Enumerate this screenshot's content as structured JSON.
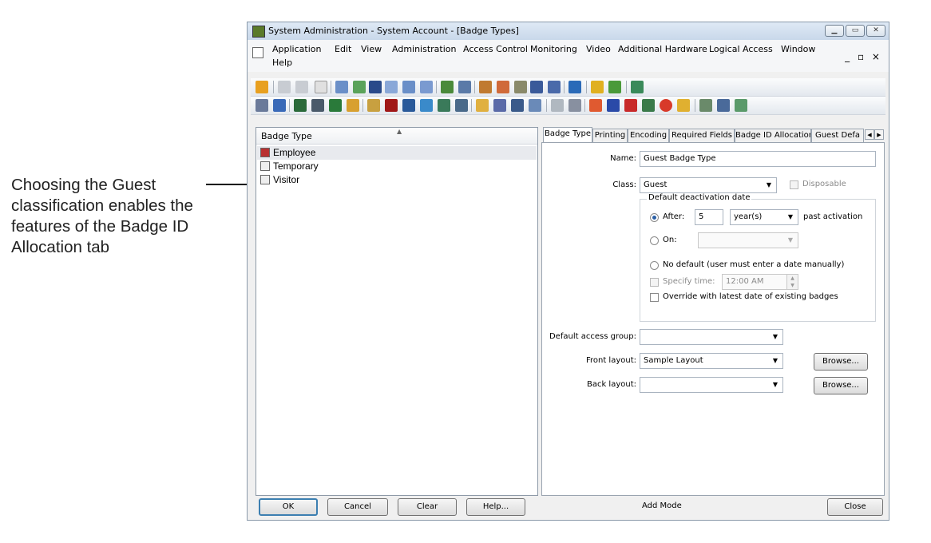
{
  "callout": {
    "lines": [
      "Choosing the Guest",
      "classification enables the",
      "features of the Badge ID",
      "Allocation tab"
    ]
  },
  "window": {
    "title": "System Administration - System Account - [Badge Types]",
    "controls": [
      "minimize-icon",
      "maximize-icon",
      "close-icon"
    ],
    "mdi_controls": "_ ▫ ×"
  },
  "menu": {
    "items": [
      "Application",
      "Edit",
      "View",
      "Administration",
      "Access Control",
      "Monitoring",
      "Video",
      "Additional Hardware",
      "Logical Access",
      "Window",
      "Help"
    ]
  },
  "list": {
    "header": "Badge Type",
    "items": [
      "Employee",
      "Temporary",
      "Visitor"
    ]
  },
  "tabs": [
    "Badge Type",
    "Printing",
    "Encoding",
    "Required Fields",
    "Badge ID Allocation",
    "Guest Defa"
  ],
  "form": {
    "name_label": "Name:",
    "name_value": "Guest Badge Type",
    "class_label": "Class:",
    "class_value": "Guest",
    "disposable_label": "Disposable",
    "deactivation_group": "Default deactivation date",
    "after_label": "After:",
    "after_value": "5",
    "unit_value": "year(s)",
    "past_activation": "past activation",
    "on_label": "On:",
    "no_default_label": "No default (user must enter a date manually)",
    "specify_time_label": "Specify time:",
    "time_value": "12:00 AM",
    "override_label": "Override with latest date of existing badges",
    "access_group_label": "Default access group:",
    "access_group_value": "",
    "front_layout_label": "Front layout:",
    "front_layout_value": "Sample Layout",
    "back_layout_label": "Back layout:",
    "back_layout_value": "",
    "browse_label": "Browse..."
  },
  "footer": {
    "ok": "OK",
    "cancel": "Cancel",
    "clear": "Clear",
    "help": "Help...",
    "mode": "Add Mode",
    "close": "Close"
  },
  "colors": {
    "accent": "#3c7fb1",
    "radio_dot": "#2a5fa5",
    "border": "#8e9aa8"
  }
}
